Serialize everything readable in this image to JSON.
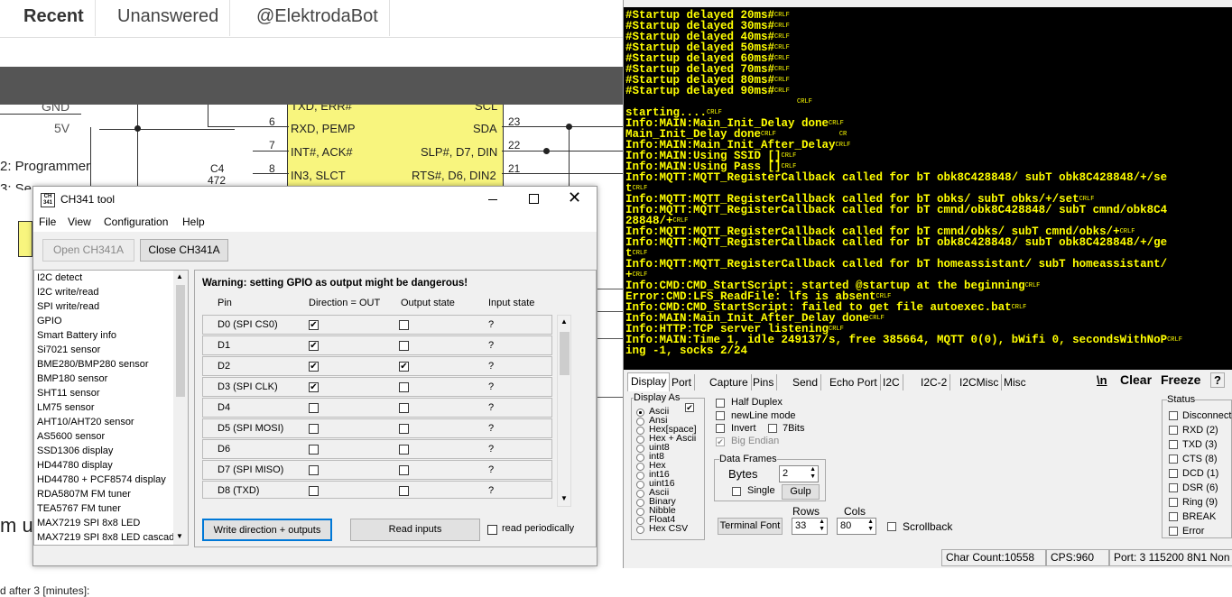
{
  "forum": {
    "tabs": [
      "Recent",
      "Unanswered",
      "@ElektrodaBot"
    ],
    "bottom_text": "d after 3 [minutes]:",
    "side_fragment": "m u"
  },
  "schematic": {
    "labels": [
      "GND",
      "5V",
      "2: Programmer",
      "3: Se",
      "C4",
      "472",
      "6",
      "7",
      "8",
      "RXD, PEMP",
      "INT#, ACK#",
      "IN3, SLCT",
      "TXD, ERR#",
      "SCL",
      "SDA",
      "SLP#, D7, DIN",
      "RTS#, D6, DIN2",
      "23",
      "22",
      "21"
    ]
  },
  "ch341": {
    "title": "CH341 tool",
    "menu": [
      "File",
      "View",
      "Configuration",
      "Help"
    ],
    "open_btn": "Open CH341A",
    "close_btn": "Close CH341A",
    "list": [
      "I2C detect",
      "I2C write/read",
      "SPI write/read",
      "GPIO",
      "Smart Battery info",
      "Si7021 sensor",
      "BME280/BMP280 sensor",
      "BMP180 sensor",
      "SHT11 sensor",
      "LM75 sensor",
      "AHT10/AHT20 sensor",
      "AS5600 sensor",
      "SSD1306 display",
      "HD44780 display",
      "HD44780 + PCF8574 display",
      "RDA5807M FM tuner",
      "TEA5767 FM tuner",
      "MAX7219 SPI 8x8 LED",
      "MAX7219 SPI 8x8 LED cascade"
    ],
    "warning": "Warning: setting GPIO as output might be dangerous!",
    "headers": [
      "Pin",
      "Direction = OUT",
      "Output state",
      "Input state"
    ],
    "rows": [
      {
        "pin": "D0 (SPI CS0)",
        "dir": "✔",
        "out": "",
        "in": "?"
      },
      {
        "pin": "D1",
        "dir": "✔",
        "out": "",
        "in": "?"
      },
      {
        "pin": "D2",
        "dir": "✔",
        "out": "✔",
        "in": "?"
      },
      {
        "pin": "D3 (SPI CLK)",
        "dir": "✔",
        "out": "",
        "in": "?"
      },
      {
        "pin": "D4",
        "dir": "",
        "out": "",
        "in": "?"
      },
      {
        "pin": "D5 (SPI MOSI)",
        "dir": "",
        "out": "",
        "in": "?"
      },
      {
        "pin": "D6",
        "dir": "",
        "out": "",
        "in": "?"
      },
      {
        "pin": "D7 (SPI MISO)",
        "dir": "",
        "out": "",
        "in": "?"
      },
      {
        "pin": "D8 (TXD)",
        "dir": "",
        "out": "",
        "in": "?"
      }
    ],
    "write_btn": "Write direction + outputs",
    "read_btn": "Read inputs",
    "periodic_label": "read periodically"
  },
  "terminal": {
    "lines": [
      "#Startup delayed 20ms#",
      "#Startup delayed 30ms#",
      "#Startup delayed 40ms#",
      "#Startup delayed 50ms#",
      "#Startup delayed 60ms#",
      "#Startup delayed 70ms#",
      "#Startup delayed 80ms#",
      "#Startup delayed 90ms#",
      "",
      "starting....",
      "Info:MAIN:Main_Init_Delay done",
      "Main_Init_Delay done",
      "Info:MAIN:Main_Init_After_Delay",
      "Info:MAIN:Using SSID []",
      "Info:MAIN:Using Pass []",
      "Info:MQTT:MQTT_RegisterCallback called for bT obk8C428848/ subT obk8C428848/+/se",
      "t",
      "Info:MQTT:MQTT_RegisterCallback called for bT obks/ subT obks/+/set",
      "Info:MQTT:MQTT_RegisterCallback called for bT cmnd/obk8C428848/ subT cmnd/obk8C4",
      "28848/+",
      "Info:MQTT:MQTT_RegisterCallback called for bT cmnd/obks/ subT cmnd/obks/+",
      "Info:MQTT:MQTT_RegisterCallback called for bT obk8C428848/ subT obk8C428848/+/ge",
      "t",
      "Info:MQTT:MQTT_RegisterCallback called for bT homeassistant/ subT homeassistant/",
      "+",
      "Info:CMD:CMD_StartScript: started @startup at the beginning",
      "Error:CMD:LFS_ReadFile: lfs is absent",
      "Info:CMD:CMD_StartScript: failed to get file autoexec.bat",
      "Info:MAIN:Main_Init_After_Delay done",
      "Info:HTTP:TCP server listening",
      "Info:MAIN:Time 1, idle 249137/s, free 385664, MQTT 0(0), bWifi 0, secondsWithNoP",
      "ing -1, socks 2/24"
    ],
    "crlf": "CRLF",
    "cr": "CR",
    "tabs": [
      "Display",
      "Port",
      "Capture",
      "Pins",
      "Send",
      "Echo Port",
      "I2C",
      "I2C-2",
      "I2CMisc",
      "Misc"
    ],
    "newline_btn": "\\n",
    "clear_btn": "Clear",
    "freeze_btn": "Freeze",
    "help_btn": "?",
    "display_as": "Display As",
    "formats": [
      "Ascii",
      "Ansi",
      "Hex[space]",
      "Hex + Ascii",
      "uint8",
      "int8",
      "Hex",
      "int16",
      "uint16",
      "Ascii",
      "Binary",
      "Nibble",
      "Float4",
      "Hex CSV"
    ],
    "opts": [
      "Half Duplex",
      "newLine mode",
      "Invert",
      "7Bits",
      "Big Endian"
    ],
    "data_frames": "Data Frames",
    "bytes_label": "Bytes",
    "bytes_val": "2",
    "single_label": "Single",
    "gulp_btn": "Gulp",
    "rows_label": "Rows",
    "cols_label": "Cols",
    "rows_val": "33",
    "cols_val": "80",
    "font_btn": "Terminal Font",
    "scrollback": "Scrollback",
    "status_title": "Status",
    "status": [
      "Disconnect",
      "RXD (2)",
      "TXD (3)",
      "CTS (8)",
      "DCD (1)",
      "DSR (6)",
      "Ring (9)",
      "BREAK",
      "Error"
    ],
    "char_count": "Char Count:10558",
    "cps": "CPS:960",
    "port": "Port: 3 115200 8N1 Non"
  }
}
